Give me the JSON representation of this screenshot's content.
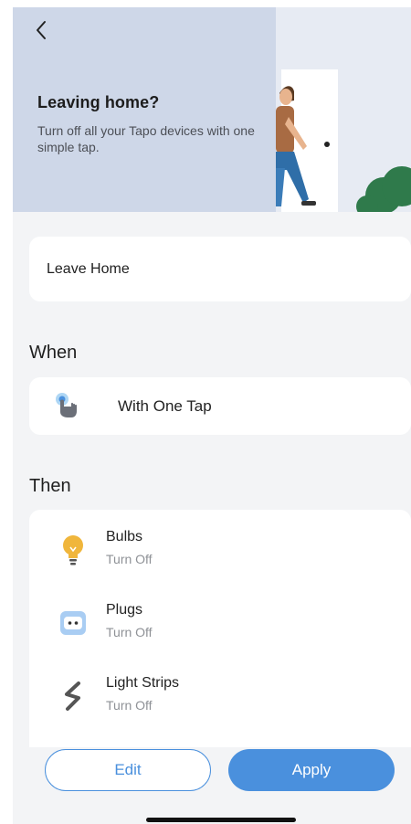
{
  "header": {
    "back_icon": "chevron-left-icon",
    "title": "Leaving home?",
    "subtitle": "Turn off all your Tapo devices with one simple tap."
  },
  "scene_name": "Leave Home",
  "when": {
    "heading": "When",
    "trigger_label": "With One Tap",
    "trigger_icon": "tap-hand-icon"
  },
  "then": {
    "heading": "Then",
    "devices": [
      {
        "label": "Bulbs",
        "action": "Turn Off",
        "icon": "bulb-icon"
      },
      {
        "label": "Plugs",
        "action": "Turn Off",
        "icon": "plug-icon"
      },
      {
        "label": "Light Strips",
        "action": "Turn Off",
        "icon": "light-strip-icon"
      }
    ]
  },
  "footer": {
    "edit_label": "Edit",
    "apply_label": "Apply"
  },
  "colors": {
    "accent": "#4a90dd",
    "hero_panel": "#ced7e8",
    "background": "#f3f4f6"
  }
}
